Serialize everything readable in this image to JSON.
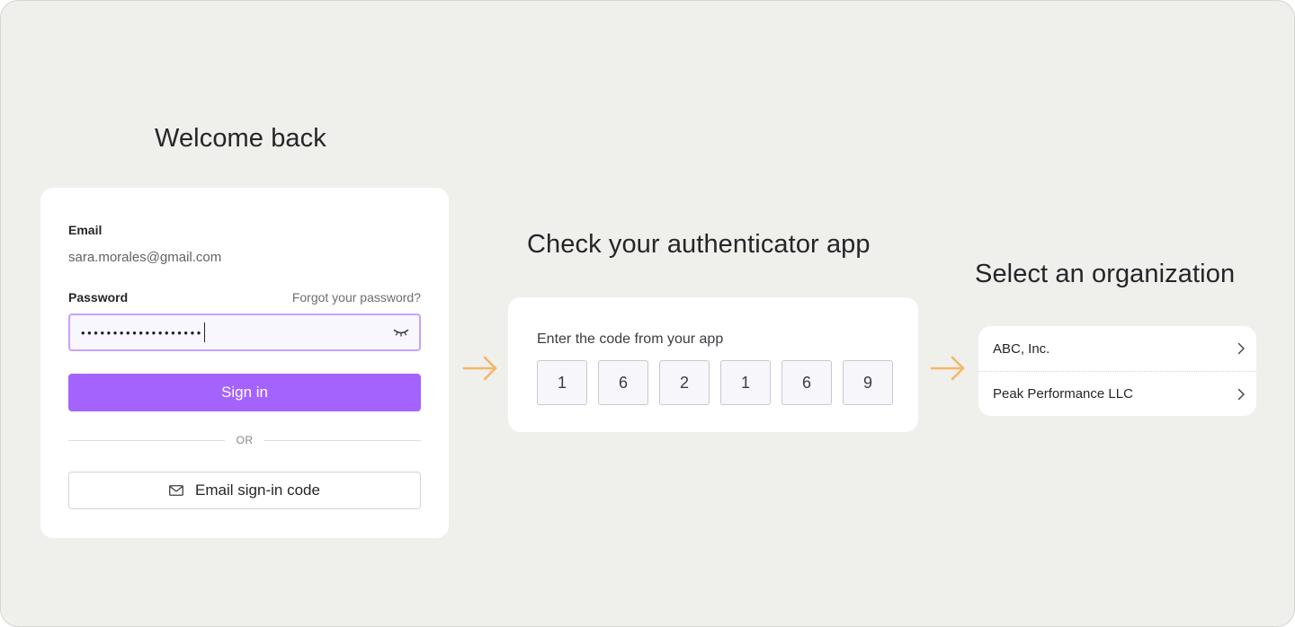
{
  "login": {
    "heading": "Welcome back",
    "email_label": "Email",
    "email_value": "sara.morales@gmail.com",
    "password_label": "Password",
    "forgot_link": "Forgot your password?",
    "password_mask": "•••••••••••••••••••",
    "eye_icon": "eye-closed-icon",
    "signin_button": "Sign in",
    "divider_text": "OR",
    "email_code_button": "Email sign-in code",
    "mail_icon": "mail-icon"
  },
  "auth": {
    "heading": "Check your authenticator app",
    "code_label": "Enter the code from your app",
    "digits": [
      "1",
      "6",
      "2",
      "1",
      "6",
      "9"
    ]
  },
  "org": {
    "heading": "Select an organization",
    "items": [
      {
        "label": "ABC, Inc."
      },
      {
        "label": "Peak Performance LLC"
      }
    ],
    "chevron_icon": "chevron-right-icon"
  },
  "colors": {
    "background": "#eff0eb",
    "card": "#ffffff",
    "accent": "#a463fd",
    "input_focus_border": "#c5a3fb",
    "arrow": "#f6b56a",
    "text": "#24262a",
    "muted_text": "#6b6e73"
  },
  "icons": {
    "flow_arrow": "arrow-right-icon"
  }
}
